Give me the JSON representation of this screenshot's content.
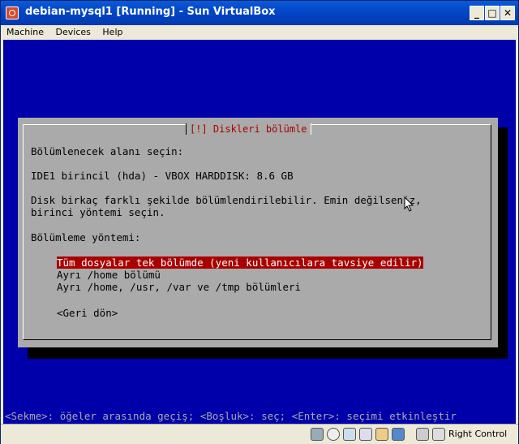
{
  "window": {
    "title": "debian-mysql1 [Running] - Sun VirtualBox"
  },
  "menu": [
    "Machine",
    "Devices",
    "Help"
  ],
  "dialog": {
    "title": "[!] Diskleri bölümle",
    "prompt": "Bölümlenecek alanı seçin:",
    "disk": "IDE1 birincil (hda) - VBOX HARDDISK: 8.6 GB",
    "info_line1": "Disk birkaç farklı şekilde bölümlendirilebilir. Emin değilseniz,",
    "info_line2": "birinci yöntemi seçin.",
    "method_label": "Bölümleme yöntemi:",
    "options": [
      "Tüm dosyalar tek bölümde (yeni kullanıcılara tavsiye edilir)",
      "Ayrı /home bölümü",
      "Ayrı /home, /usr, /var ve /tmp bölümleri"
    ],
    "selected_option": 0,
    "back_button": "<Geri dön>"
  },
  "help_line": "<Sekme>: öğeler arasında geçiş; <Boşluk>: seç; <Enter>: seçimi etkinleştir",
  "statusbar": {
    "host_key": "Right Control"
  },
  "colors": {
    "screen": "#0000aa",
    "dialog": "#aaaaaa",
    "title_text": "#aa0000",
    "selection": "#aa0000"
  },
  "icons": [
    "hard-disk-icon",
    "cd-icon",
    "network-icon",
    "usb-icon",
    "shared-folder-icon",
    "display-icon",
    "virtualization-icon",
    "mouse-capture-icon",
    "host-key-icon"
  ]
}
